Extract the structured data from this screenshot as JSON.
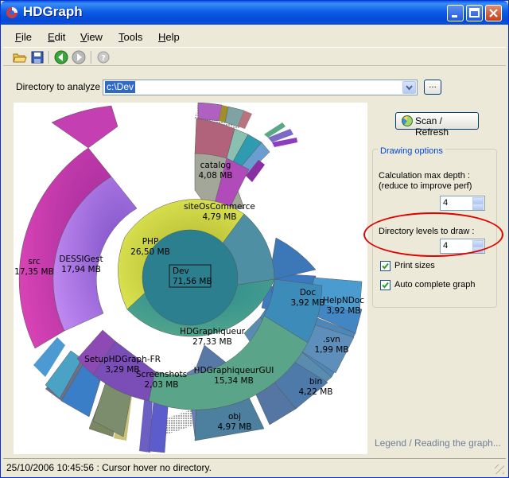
{
  "window": {
    "title": "HDGraph",
    "controls": [
      "minimize-icon",
      "maximize-icon",
      "close-icon"
    ]
  },
  "menu": {
    "file": "File",
    "edit": "Edit",
    "view": "View",
    "tools": "Tools",
    "help": "Help"
  },
  "toolbar": {
    "icons": [
      "open-folder-icon",
      "save-icon",
      "back-icon",
      "forward-icon",
      "help-icon"
    ]
  },
  "directory": {
    "label": "Directory to analyze :",
    "value": "c:\\Dev",
    "browse_label": "..."
  },
  "graph": {
    "root": {
      "name": "Dev",
      "size": "71,56 MB"
    },
    "labels": [
      {
        "name": "catalog",
        "size": "4,08 MB"
      },
      {
        "name": "siteOsCommerce",
        "size": "4,79 MB"
      },
      {
        "name": "PHP",
        "size": "26,50 MB"
      },
      {
        "name": "src",
        "size": "17,35 MB"
      },
      {
        "name": "DESSIGest",
        "size": "17,94 MB"
      },
      {
        "name": "Doc",
        "size": "3,92 MB"
      },
      {
        "name": "HelpNDoc",
        "size": "3,92 MB"
      },
      {
        "name": ".svn",
        "size": "1,99 MB"
      },
      {
        "name": "HDGraphiqueur",
        "size": "27,33 MB"
      },
      {
        "name": "HDGraphiqueurGUI",
        "size": "15,34 MB"
      },
      {
        "name": "bin",
        "size": "4,22 MB"
      },
      {
        "name": "SetupHDGraph-FR",
        "size": "3,29 MB"
      },
      {
        "name": "Screenshots",
        "size": "2,03 MB"
      },
      {
        "name": "obj",
        "size": "4,97 MB"
      }
    ]
  },
  "options": {
    "scan_label": "Scan / Refresh",
    "group_title": "Drawing options",
    "max_depth_label_line1": "Calculation max depth :",
    "max_depth_label_line2": "(reduce to improve perf)",
    "max_depth_value": "4",
    "levels_label": "Directory levels to draw :",
    "levels_value": "4",
    "print_sizes_label": "Print sizes",
    "print_sizes_checked": true,
    "auto_complete_label": "Auto complete graph",
    "auto_complete_checked": true,
    "legend_link": "Legend / Reading the graph..."
  },
  "status": {
    "text": "25/10/2006 10:45:56 : Cursor hover no directory."
  },
  "colors": {
    "title_bar": "#0549d7",
    "highlight": "#316ac5",
    "annotation_red": "#e00000"
  }
}
